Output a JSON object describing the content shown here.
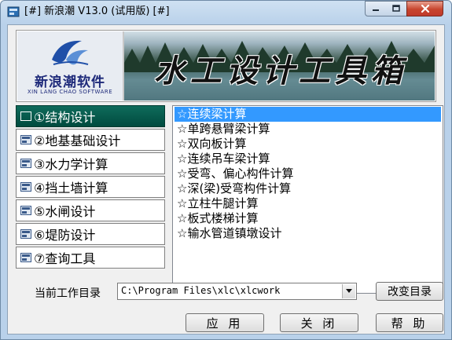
{
  "window": {
    "title": "[#] 新浪潮 V13.0 (试用版) [#]",
    "close_color": "#c0392b"
  },
  "banner": {
    "logo_cn": "新浪潮软件",
    "logo_en": "XIN LANG CHAO SOFTWARE",
    "title": "水工设计工具箱"
  },
  "menu": {
    "items": [
      {
        "label": "①结构设计",
        "active": true
      },
      {
        "label": "②地基基础设计",
        "active": false
      },
      {
        "label": "③水力学计算",
        "active": false
      },
      {
        "label": "④挡土墙计算",
        "active": false
      },
      {
        "label": "⑤水闸设计",
        "active": false
      },
      {
        "label": "⑥堤防设计",
        "active": false
      },
      {
        "label": "⑦查询工具",
        "active": false
      }
    ]
  },
  "list": {
    "items": [
      {
        "label": "☆连续梁计算",
        "selected": true
      },
      {
        "label": "☆单跨悬臂梁计算",
        "selected": false
      },
      {
        "label": "☆双向板计算",
        "selected": false
      },
      {
        "label": "☆连续吊车梁计算",
        "selected": false
      },
      {
        "label": "☆受弯、偏心构件计算",
        "selected": false
      },
      {
        "label": "☆深(梁)受弯构件计算",
        "selected": false
      },
      {
        "label": "☆立柱牛腿计算",
        "selected": false
      },
      {
        "label": "☆板式楼梯计算",
        "selected": false
      },
      {
        "label": "☆输水管道镇墩设计",
        "selected": false
      }
    ]
  },
  "workdir": {
    "label": "当前工作目录",
    "value": "C:\\Program Files\\xlc\\xlcwork",
    "change_button": "改变目录"
  },
  "buttons": {
    "apply": "应 用",
    "close": "关 闭",
    "help": "帮 助"
  }
}
